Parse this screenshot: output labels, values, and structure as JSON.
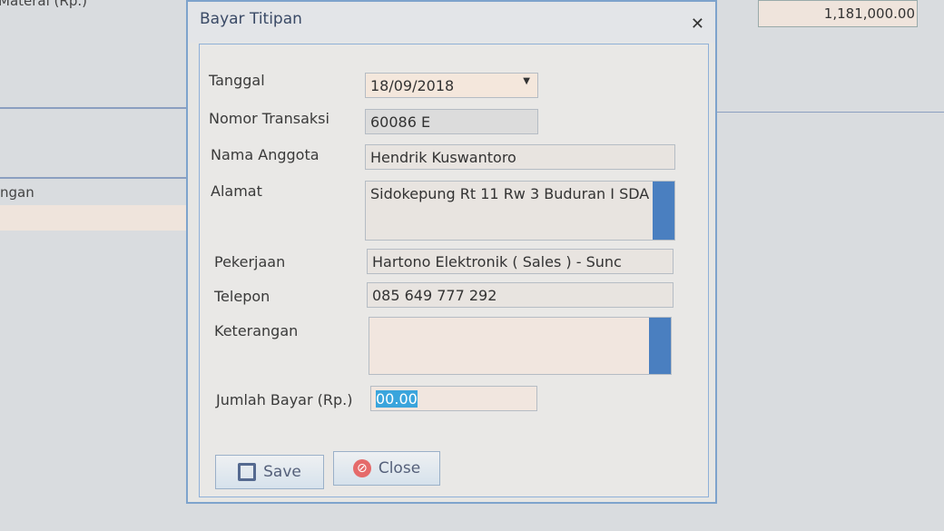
{
  "background": {
    "label_top": "Materai (Rp.)",
    "label_mid": "ngan",
    "value_top": "1,181,000.00"
  },
  "dialog": {
    "title": "Bayar Titipan",
    "close_icon": "close-x-icon",
    "fields": {
      "tanggal": {
        "label": "Tanggal",
        "value": "18/09/2018"
      },
      "nomor": {
        "label": "Nomor Transaksi",
        "value": "60086 E"
      },
      "nama": {
        "label": "Nama Anggota",
        "value": "Hendrik Kuswantoro"
      },
      "alamat": {
        "label": "Alamat",
        "value": "Sidokepung Rt 11 Rw 3 Buduran I SDA"
      },
      "pekerjaan": {
        "label": "Pekerjaan",
        "value": "Hartono Elektronik ( Sales ) - Sunc"
      },
      "telepon": {
        "label": "Telepon",
        "value": "085 649 777 292"
      },
      "keterangan": {
        "label": "Keterangan",
        "value": ""
      },
      "jumlah": {
        "label": "Jumlah Bayar (Rp.)",
        "value": "00.00"
      }
    },
    "buttons": {
      "save": "Save",
      "close": "Close"
    },
    "colors": {
      "accent": "#4a7fc0",
      "selection": "#3aa5dc"
    }
  }
}
